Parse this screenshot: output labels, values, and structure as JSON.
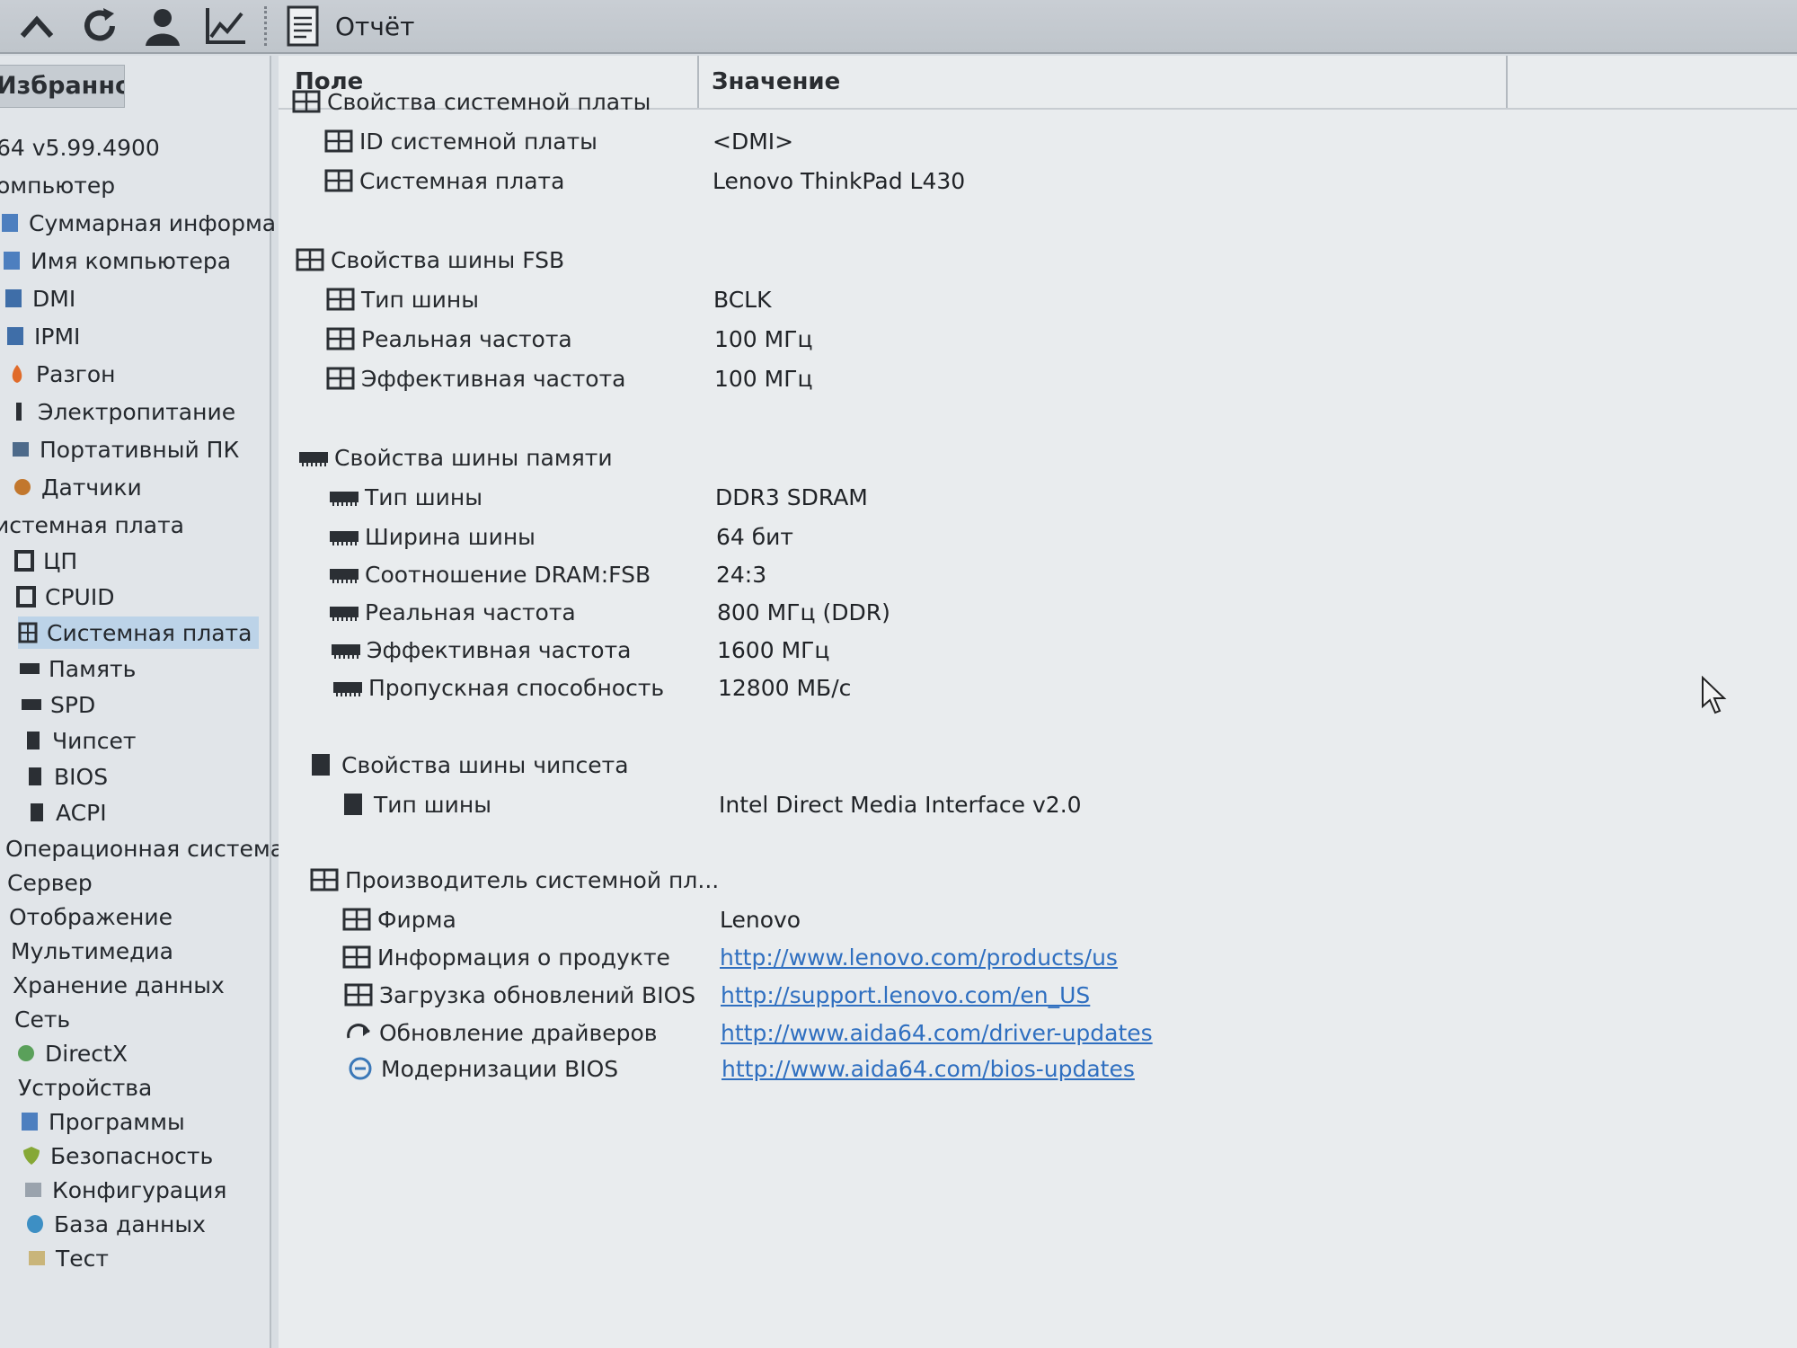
{
  "toolbar": {
    "buttons": [
      "up-icon",
      "refresh-icon",
      "user-icon",
      "chart-icon"
    ],
    "report_label": "Отчёт"
  },
  "sidebar": {
    "favorites_tab": "Избранное",
    "items": [
      {
        "label": "64 v5.99.4900",
        "icon": "none"
      },
      {
        "label": "омпьютер",
        "icon": "none"
      },
      {
        "label": "Суммарная информа",
        "icon": "summary-icon"
      },
      {
        "label": "Имя компьютера",
        "icon": "computer-icon"
      },
      {
        "label": "DMI",
        "icon": "dmi-icon"
      },
      {
        "label": "IPMI",
        "icon": "ipmi-icon"
      },
      {
        "label": "Разгон",
        "icon": "flame-icon"
      },
      {
        "label": "Электропитание",
        "icon": "plug-icon"
      },
      {
        "label": "Портативный ПК",
        "icon": "laptop-icon"
      },
      {
        "label": "Датчики",
        "icon": "sensor-icon"
      },
      {
        "label": "истемная плата",
        "icon": "none"
      },
      {
        "label": "ЦП",
        "icon": "cpu-icon"
      },
      {
        "label": "CPUID",
        "icon": "cpu-icon"
      },
      {
        "label": "Системная плата",
        "icon": "motherboard-icon",
        "selected": true
      },
      {
        "label": "Память",
        "icon": "memory-icon"
      },
      {
        "label": "SPD",
        "icon": "memory-icon"
      },
      {
        "label": "Чипсет",
        "icon": "chipset-icon"
      },
      {
        "label": "BIOS",
        "icon": "chipset-icon"
      },
      {
        "label": "ACPI",
        "icon": "chipset-icon"
      },
      {
        "label": "Операционная система",
        "icon": "none"
      },
      {
        "label": "Сервер",
        "icon": "none"
      },
      {
        "label": "Отображение",
        "icon": "none"
      },
      {
        "label": "Мультимедиа",
        "icon": "none"
      },
      {
        "label": "Хранение данных",
        "icon": "none"
      },
      {
        "label": "Сеть",
        "icon": "none"
      },
      {
        "label": "DirectX",
        "icon": "directx-icon"
      },
      {
        "label": "Устройства",
        "icon": "none"
      },
      {
        "label": "Программы",
        "icon": "programs-icon"
      },
      {
        "label": "Безопасность",
        "icon": "shield-icon"
      },
      {
        "label": "Конфигурация",
        "icon": "config-icon"
      },
      {
        "label": "База данных",
        "icon": "database-icon"
      },
      {
        "label": "Тест",
        "icon": "test-icon"
      }
    ]
  },
  "table": {
    "col_field": "Поле",
    "col_value": "Значение",
    "rows": [
      {
        "field": "Свойства системной платы",
        "value": "",
        "kind": "group",
        "icon": "motherboard-icon"
      },
      {
        "field": "ID системной платы",
        "value": "<DMI>",
        "kind": "item",
        "icon": "motherboard-icon"
      },
      {
        "field": "Системная плата",
        "value": "Lenovo ThinkPad L430",
        "kind": "item",
        "icon": "motherboard-icon"
      },
      {
        "field": "Свойства шины FSB",
        "value": "",
        "kind": "group",
        "icon": "motherboard-icon"
      },
      {
        "field": "Тип шины",
        "value": "BCLK",
        "kind": "item",
        "icon": "motherboard-icon"
      },
      {
        "field": "Реальная частота",
        "value": "100 МГц",
        "kind": "item",
        "icon": "motherboard-icon"
      },
      {
        "field": "Эффективная частота",
        "value": "100 МГц",
        "kind": "item",
        "icon": "motherboard-icon"
      },
      {
        "field": "Свойства шины памяти",
        "value": "",
        "kind": "group",
        "icon": "memory-icon"
      },
      {
        "field": "Тип шины",
        "value": "DDR3 SDRAM",
        "kind": "item",
        "icon": "memory-icon"
      },
      {
        "field": "Ширина шины",
        "value": "64 бит",
        "kind": "item",
        "icon": "memory-icon"
      },
      {
        "field": "Соотношение DRAM:FSB",
        "value": "24:3",
        "kind": "item",
        "icon": "memory-icon"
      },
      {
        "field": "Реальная частота",
        "value": "800 МГц (DDR)",
        "kind": "item",
        "icon": "memory-icon"
      },
      {
        "field": "Эффективная частота",
        "value": "1600 МГц",
        "kind": "item",
        "icon": "memory-icon"
      },
      {
        "field": "Пропускная способность",
        "value": "12800 МБ/с",
        "kind": "item",
        "icon": "memory-icon"
      },
      {
        "field": "Свойства шины чипсета",
        "value": "",
        "kind": "group",
        "icon": "chipset-icon"
      },
      {
        "field": "Тип шины",
        "value": "Intel Direct Media Interface v2.0",
        "kind": "item",
        "icon": "chipset-icon"
      },
      {
        "field": "Производитель системной пл...",
        "value": "",
        "kind": "group",
        "icon": "motherboard-icon"
      },
      {
        "field": "Фирма",
        "value": "Lenovo",
        "kind": "item",
        "icon": "motherboard-icon"
      },
      {
        "field": "Информация о продукте",
        "value": "http://www.lenovo.com/products/us",
        "kind": "link",
        "icon": "motherboard-icon"
      },
      {
        "field": "Загрузка обновлений BIOS",
        "value": "http://support.lenovo.com/en_US",
        "kind": "link",
        "icon": "motherboard-icon"
      },
      {
        "field": "Обновление драйверов",
        "value": "http://www.aida64.com/driver-updates",
        "kind": "link",
        "icon": "driver-update-icon"
      },
      {
        "field": "Модернизации BIOS",
        "value": "http://www.aida64.com/bios-updates",
        "kind": "link",
        "icon": "bios-update-icon"
      }
    ]
  }
}
